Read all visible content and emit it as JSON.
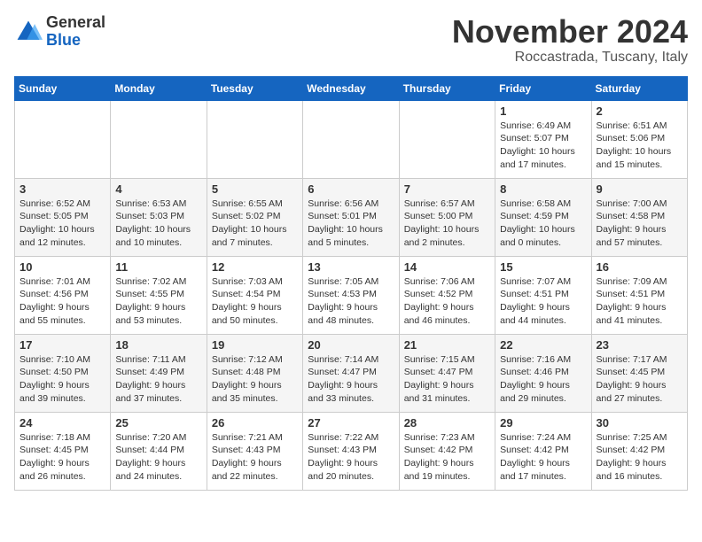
{
  "header": {
    "logo_line1": "General",
    "logo_line2": "Blue",
    "month": "November 2024",
    "location": "Roccastrada, Tuscany, Italy"
  },
  "weekdays": [
    "Sunday",
    "Monday",
    "Tuesday",
    "Wednesday",
    "Thursday",
    "Friday",
    "Saturday"
  ],
  "weeks": [
    [
      {
        "day": "",
        "detail": ""
      },
      {
        "day": "",
        "detail": ""
      },
      {
        "day": "",
        "detail": ""
      },
      {
        "day": "",
        "detail": ""
      },
      {
        "day": "",
        "detail": ""
      },
      {
        "day": "1",
        "detail": "Sunrise: 6:49 AM\nSunset: 5:07 PM\nDaylight: 10 hours and 17 minutes."
      },
      {
        "day": "2",
        "detail": "Sunrise: 6:51 AM\nSunset: 5:06 PM\nDaylight: 10 hours and 15 minutes."
      }
    ],
    [
      {
        "day": "3",
        "detail": "Sunrise: 6:52 AM\nSunset: 5:05 PM\nDaylight: 10 hours and 12 minutes."
      },
      {
        "day": "4",
        "detail": "Sunrise: 6:53 AM\nSunset: 5:03 PM\nDaylight: 10 hours and 10 minutes."
      },
      {
        "day": "5",
        "detail": "Sunrise: 6:55 AM\nSunset: 5:02 PM\nDaylight: 10 hours and 7 minutes."
      },
      {
        "day": "6",
        "detail": "Sunrise: 6:56 AM\nSunset: 5:01 PM\nDaylight: 10 hours and 5 minutes."
      },
      {
        "day": "7",
        "detail": "Sunrise: 6:57 AM\nSunset: 5:00 PM\nDaylight: 10 hours and 2 minutes."
      },
      {
        "day": "8",
        "detail": "Sunrise: 6:58 AM\nSunset: 4:59 PM\nDaylight: 10 hours and 0 minutes."
      },
      {
        "day": "9",
        "detail": "Sunrise: 7:00 AM\nSunset: 4:58 PM\nDaylight: 9 hours and 57 minutes."
      }
    ],
    [
      {
        "day": "10",
        "detail": "Sunrise: 7:01 AM\nSunset: 4:56 PM\nDaylight: 9 hours and 55 minutes."
      },
      {
        "day": "11",
        "detail": "Sunrise: 7:02 AM\nSunset: 4:55 PM\nDaylight: 9 hours and 53 minutes."
      },
      {
        "day": "12",
        "detail": "Sunrise: 7:03 AM\nSunset: 4:54 PM\nDaylight: 9 hours and 50 minutes."
      },
      {
        "day": "13",
        "detail": "Sunrise: 7:05 AM\nSunset: 4:53 PM\nDaylight: 9 hours and 48 minutes."
      },
      {
        "day": "14",
        "detail": "Sunrise: 7:06 AM\nSunset: 4:52 PM\nDaylight: 9 hours and 46 minutes."
      },
      {
        "day": "15",
        "detail": "Sunrise: 7:07 AM\nSunset: 4:51 PM\nDaylight: 9 hours and 44 minutes."
      },
      {
        "day": "16",
        "detail": "Sunrise: 7:09 AM\nSunset: 4:51 PM\nDaylight: 9 hours and 41 minutes."
      }
    ],
    [
      {
        "day": "17",
        "detail": "Sunrise: 7:10 AM\nSunset: 4:50 PM\nDaylight: 9 hours and 39 minutes."
      },
      {
        "day": "18",
        "detail": "Sunrise: 7:11 AM\nSunset: 4:49 PM\nDaylight: 9 hours and 37 minutes."
      },
      {
        "day": "19",
        "detail": "Sunrise: 7:12 AM\nSunset: 4:48 PM\nDaylight: 9 hours and 35 minutes."
      },
      {
        "day": "20",
        "detail": "Sunrise: 7:14 AM\nSunset: 4:47 PM\nDaylight: 9 hours and 33 minutes."
      },
      {
        "day": "21",
        "detail": "Sunrise: 7:15 AM\nSunset: 4:47 PM\nDaylight: 9 hours and 31 minutes."
      },
      {
        "day": "22",
        "detail": "Sunrise: 7:16 AM\nSunset: 4:46 PM\nDaylight: 9 hours and 29 minutes."
      },
      {
        "day": "23",
        "detail": "Sunrise: 7:17 AM\nSunset: 4:45 PM\nDaylight: 9 hours and 27 minutes."
      }
    ],
    [
      {
        "day": "24",
        "detail": "Sunrise: 7:18 AM\nSunset: 4:45 PM\nDaylight: 9 hours and 26 minutes."
      },
      {
        "day": "25",
        "detail": "Sunrise: 7:20 AM\nSunset: 4:44 PM\nDaylight: 9 hours and 24 minutes."
      },
      {
        "day": "26",
        "detail": "Sunrise: 7:21 AM\nSunset: 4:43 PM\nDaylight: 9 hours and 22 minutes."
      },
      {
        "day": "27",
        "detail": "Sunrise: 7:22 AM\nSunset: 4:43 PM\nDaylight: 9 hours and 20 minutes."
      },
      {
        "day": "28",
        "detail": "Sunrise: 7:23 AM\nSunset: 4:42 PM\nDaylight: 9 hours and 19 minutes."
      },
      {
        "day": "29",
        "detail": "Sunrise: 7:24 AM\nSunset: 4:42 PM\nDaylight: 9 hours and 17 minutes."
      },
      {
        "day": "30",
        "detail": "Sunrise: 7:25 AM\nSunset: 4:42 PM\nDaylight: 9 hours and 16 minutes."
      }
    ]
  ]
}
